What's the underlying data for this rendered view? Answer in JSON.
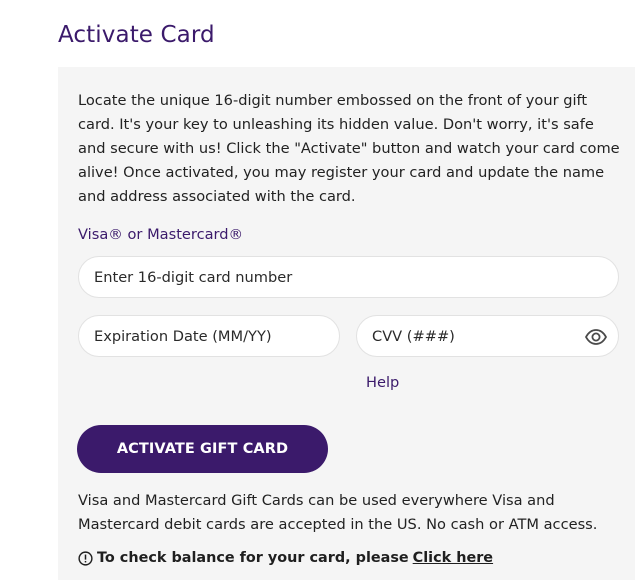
{
  "page": {
    "title": "Activate Card"
  },
  "activation": {
    "description": "Locate the unique 16-digit number embossed on the front of your gift card. It's your key to unleashing its hidden value. Don't worry, it's safe and secure with us! Click the \"Activate\" button and watch your card come alive! Once activated, you may register your card and update the name and address associated with the card.",
    "network_label": "Visa® or Mastercard®",
    "card_number_placeholder": "Enter 16-digit card number",
    "expiration_placeholder": "Expiration Date (MM/YY)",
    "cvv_placeholder": "CVV (###)",
    "cvv_toggle_icon": "eye-icon",
    "help_label": "Help",
    "activate_label": "ACTIVATE GIFT CARD",
    "usage_info": "Visa and Mastercard Gift Cards can be used everywhere Visa and Mastercard debit cards are accepted in the US. No cash or ATM access.",
    "balance_prompt": "To check balance for your card, please",
    "balance_link": "Click here",
    "balance_icon": "info-icon"
  },
  "colors": {
    "brand_purple": "#3b1a6b",
    "panel_background": "#f5f5f5",
    "field_background": "#ffffff"
  }
}
